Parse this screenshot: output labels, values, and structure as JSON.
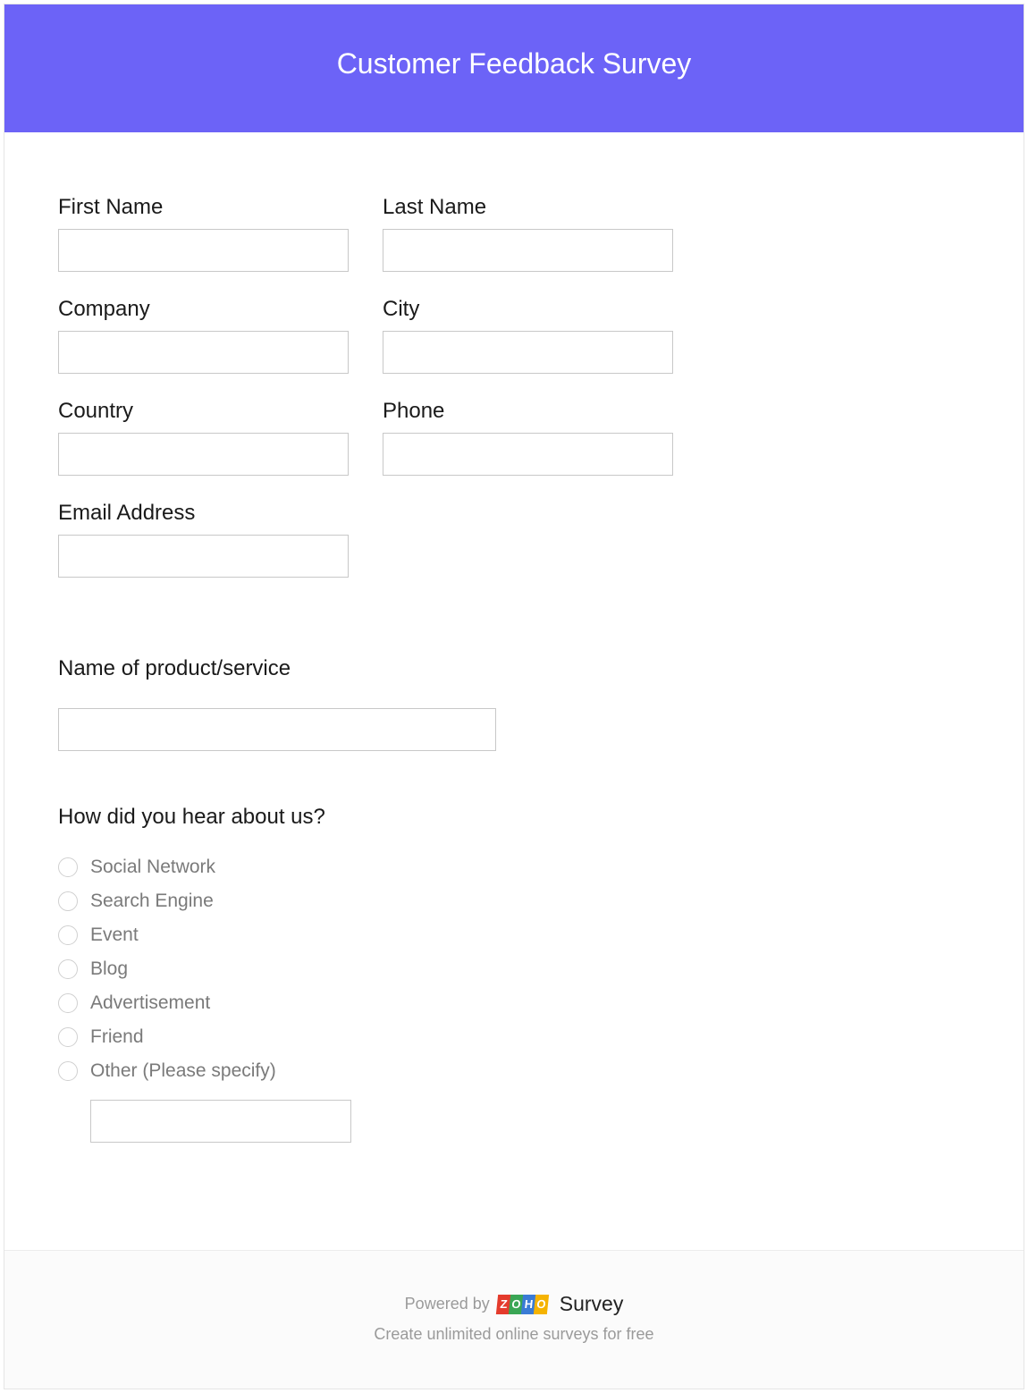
{
  "header": {
    "title": "Customer Feedback Survey"
  },
  "fields": {
    "first_name": "First Name",
    "last_name": "Last Name",
    "company": "Company",
    "city": "City",
    "country": "Country",
    "phone": "Phone",
    "email": "Email Address"
  },
  "q_product": "Name of product/service",
  "q_hear": "How did you hear about us?",
  "hear_options": [
    "Social Network",
    "Search Engine",
    "Event",
    "Blog",
    "Advertisement",
    "Friend",
    "Other (Please specify)"
  ],
  "footer": {
    "powered_by": "Powered by",
    "brand_suffix": "Survey",
    "tagline": "Create unlimited online surveys for free"
  }
}
